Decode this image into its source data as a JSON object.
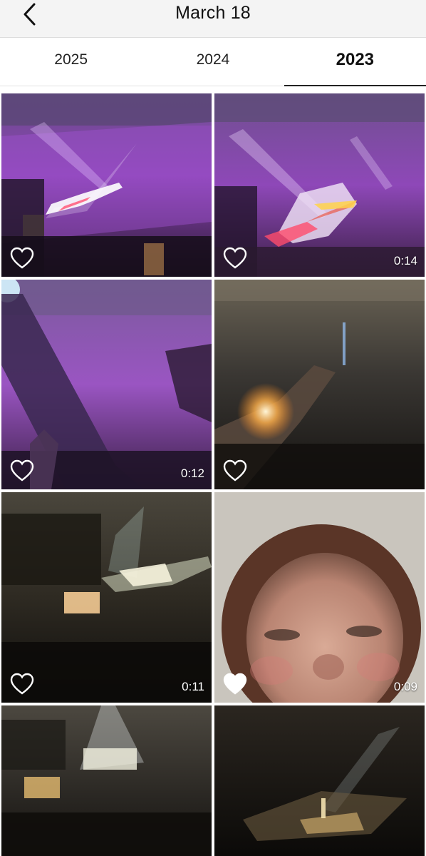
{
  "header": {
    "title": "March 18"
  },
  "tabs": [
    {
      "label": "2025",
      "active": false
    },
    {
      "label": "2024",
      "active": false
    },
    {
      "label": "2023",
      "active": true
    }
  ],
  "media": [
    {
      "duration": "",
      "favorited": false
    },
    {
      "duration": "0:14",
      "favorited": false
    },
    {
      "duration": "0:12",
      "favorited": false
    },
    {
      "duration": "",
      "favorited": false
    },
    {
      "duration": "0:11",
      "favorited": false
    },
    {
      "duration": "0:09",
      "favorited": true
    },
    {
      "duration": "",
      "favorited": false
    },
    {
      "duration": "",
      "favorited": false
    }
  ],
  "colors": {
    "accent": "#222222",
    "concert_purple": "#8a3fb0",
    "concert_dark": "#1d1a16"
  },
  "icons": {
    "back": "chevron-left-icon",
    "favorite": "heart-icon"
  }
}
